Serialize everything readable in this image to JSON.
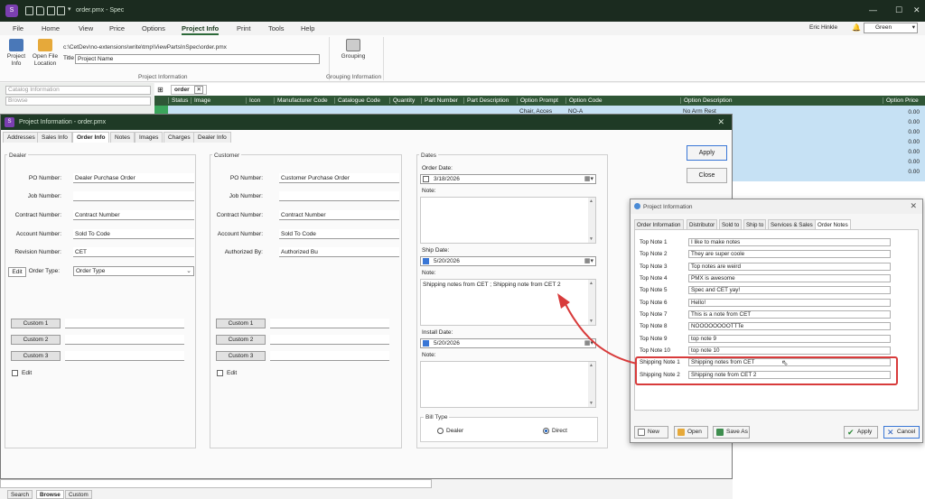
{
  "app": {
    "title": "order.pmx - Spec",
    "window_controls": {
      "minimize": "—",
      "maximize": "☐",
      "close": "✕"
    }
  },
  "ribbon": {
    "tabs": [
      "File",
      "Home",
      "View",
      "Price",
      "Options",
      "Project Info",
      "Print",
      "Tools",
      "Help"
    ],
    "active_tab": "Project Info",
    "user": "Eric Hinkle",
    "theme": "Green",
    "project_info_btn": "Project Info",
    "open_file_btn": "Open File Location",
    "path": "c:\\CetDev\\no-extensions\\write\\tmp\\ViewPartsInSpec\\order.pmx",
    "title_label": "Title",
    "title_value": "Project Name",
    "group_project_info": "Project Information",
    "grouping_btn": "Grouping",
    "group_grouping": "Grouping Information"
  },
  "left_panel": {
    "catalog_placeholder": "Catalog Information",
    "browse_placeholder": "Browse"
  },
  "grid": {
    "tab": "order",
    "columns": [
      "Status",
      "Image",
      "Icon",
      "Manufacturer Code",
      "Catalogue Code",
      "Quantity",
      "Part Number",
      "Part Description",
      "Option Prompt",
      "Option Code",
      "Option Description",
      "Option Price"
    ],
    "first_row": {
      "prompt": "Chair, Acces",
      "code": "NO-A",
      "desc": "No Arm Rest"
    },
    "prices": [
      "0.00",
      "0.00",
      "0.00",
      "0.00",
      "0.00",
      "0.00",
      "0.00"
    ]
  },
  "dialog": {
    "title": "Project Information - order.pmx",
    "tabs": [
      "Addresses",
      "Sales Info",
      "Order Info",
      "Notes",
      "Images",
      "Charges",
      "Dealer Info"
    ],
    "active_tab": "Order Info",
    "apply": "Apply",
    "close": "Close",
    "dealer": {
      "legend": "Dealer",
      "po_label": "PO Number:",
      "po_value": "Dealer Purchase Order",
      "job_label": "Job Number:",
      "job_value": "",
      "contract_label": "Contract Number:",
      "contract_value": "Contract Number",
      "account_label": "Account Number:",
      "account_value": "Sold To Code",
      "revision_label": "Revision Number:",
      "revision_value": "CET",
      "edit_btn": "Edit",
      "order_type_label": "Order Type:",
      "order_type_value": "Order Type",
      "custom": [
        "Custom 1",
        "Custom 2",
        "Custom 3"
      ],
      "edit_check": "Edit"
    },
    "customer": {
      "legend": "Customer",
      "po_label": "PO Number:",
      "po_value": "Customer Purchase Order",
      "job_label": "Job Number:",
      "job_value": "",
      "contract_label": "Contract Number:",
      "contract_value": "Contract Number",
      "account_label": "Account Number:",
      "account_value": "Sold To Code",
      "auth_label": "Authorized By:",
      "auth_value": "Authorized Bu",
      "custom": [
        "Custom 1",
        "Custom 2",
        "Custom 3"
      ],
      "edit_check": "Edit"
    },
    "dates": {
      "legend": "Dates",
      "order_label": "Order Date:",
      "order_value": "3/18/2026",
      "note_label": "Note:",
      "ship_label": "Ship Date:",
      "ship_value": "5/20/2026",
      "ship_note_label": "Note:",
      "ship_note": "Shipping notes from CET ;   Shipping note from CET 2",
      "install_label": "Install Date:",
      "install_value": "5/20/2026",
      "install_note_label": "Note:",
      "bill_type_label": "Bill Type",
      "dealer_radio": "Dealer",
      "direct_radio": "Direct"
    }
  },
  "pi_dialog": {
    "title": "Project Information",
    "tabs": [
      "Order Information",
      "Distributor",
      "Sold to",
      "Ship to",
      "Services & Sales",
      "Order Notes"
    ],
    "active_tab": "Order Notes",
    "notes": [
      {
        "label": "Top Note 1",
        "value": "I like to make notes"
      },
      {
        "label": "Top Note 2",
        "value": "They are super coole"
      },
      {
        "label": "Top Note 3",
        "value": "Top notes are weird"
      },
      {
        "label": "Top Note 4",
        "value": "PMX is awesome"
      },
      {
        "label": "Top Note 5",
        "value": "Spec and CET yay!"
      },
      {
        "label": "Top Note 6",
        "value": "Hello!"
      },
      {
        "label": "Top Note 7",
        "value": "This is a note from CET"
      },
      {
        "label": "Top Note 8",
        "value": "NOOOOOOOOTTTe"
      },
      {
        "label": "Top Note 9",
        "value": "top note 9"
      },
      {
        "label": "Top Note 10",
        "value": "top note 10"
      },
      {
        "label": "Shipping Note 1",
        "value": "Shipping notes from CET"
      },
      {
        "label": "Shipping Note 2",
        "value": "Shipping note from CET 2"
      }
    ],
    "new_btn": "New",
    "open_btn": "Open",
    "saveas_btn": "Save As",
    "apply_btn": "Apply",
    "cancel_btn": "Cancel"
  },
  "status": {
    "tabs": [
      "Search",
      "Browse",
      "Custom"
    ],
    "active_tab": "Browse"
  },
  "colors": {
    "title_bg": "#1b2b1f",
    "grid_header": "#2f5636",
    "highlight": "#d83b3b",
    "selection": "#c6e1f4"
  }
}
